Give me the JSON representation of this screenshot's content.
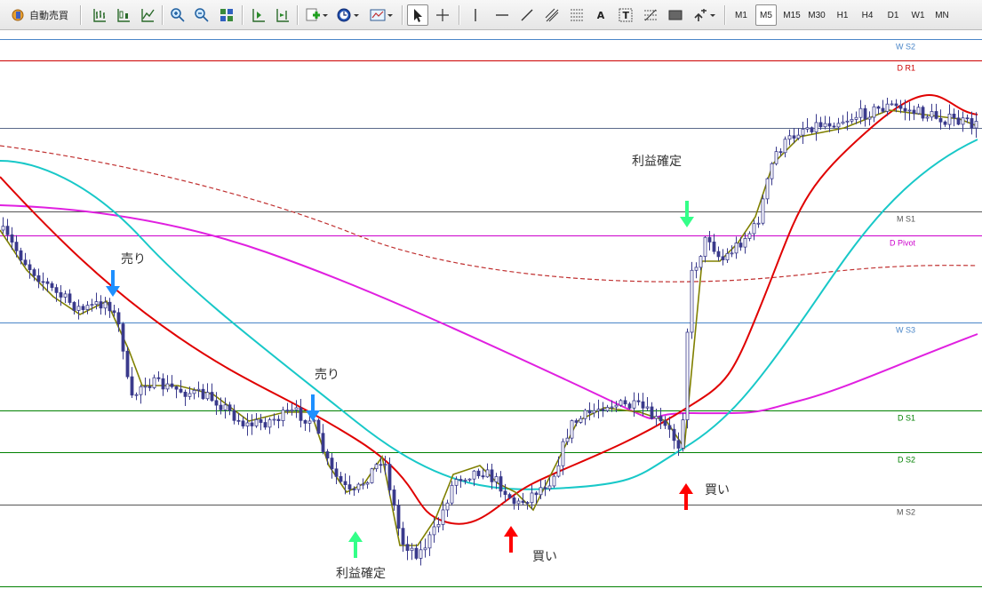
{
  "toolbar": {
    "autotrade_label": "自動売買",
    "timeframes": [
      "M1",
      "M5",
      "M15",
      "M30",
      "H1",
      "H4",
      "D1",
      "W1",
      "MN"
    ],
    "active_timeframe": "M5",
    "icons": [
      "bar-chart-icon",
      "candle-chart-icon",
      "line-chart-icon",
      "zoom-in-icon",
      "zoom-out-icon",
      "tile-windows-icon",
      "auto-scroll-icon",
      "chart-shift-icon",
      "indicators-icon",
      "periods-icon",
      "templates-icon",
      "cursor-icon",
      "crosshair-icon",
      "vertical-line-icon",
      "horizontal-line-icon",
      "trendline-icon",
      "equidistant-channel-icon",
      "fibonacci-icon",
      "text-icon",
      "text-label-icon",
      "fibo-fan-icon",
      "rectangle-icon",
      "arrows-icon"
    ],
    "text_icon_glyph": "A",
    "label_icon_glyph": "T"
  },
  "chart": {
    "colors": {
      "background": "#ffffff",
      "candle": "#3a3a8c",
      "ma_fast": "#808000",
      "ma_red": "#e00000",
      "ma_cyan": "#18c8c8",
      "ma_magenta": "#e020e0",
      "ma_long_dashed": "#c03030",
      "buy_arrow": "#ff0000",
      "sell_arrow": "#1e90ff",
      "tp_arrow": "#33ff88",
      "annotation_text": "#333333"
    },
    "levels": [
      {
        "label": "W S2",
        "color": "#4a86c8"
      },
      {
        "label": "D R1",
        "color": "#cc0000"
      },
      {
        "label": "",
        "color": "#5a6a8a"
      },
      {
        "label": "M S1",
        "color": "#555555"
      },
      {
        "label": "D Pivot",
        "color": "#cc00cc"
      },
      {
        "label": "W S3",
        "color": "#4a86c8"
      },
      {
        "label": "D S1",
        "color": "#008000"
      },
      {
        "label": "D S2",
        "color": "#008000"
      },
      {
        "label": "M S2",
        "color": "#555555"
      },
      {
        "label": "",
        "color": "#008000"
      }
    ],
    "annotations": {
      "sell_1": "売り",
      "sell_2": "売り",
      "take_profit_1": "利益確定",
      "take_profit_2": "利益確定",
      "buy_1": "買い",
      "buy_2": "買い"
    },
    "candle_count": 220
  }
}
